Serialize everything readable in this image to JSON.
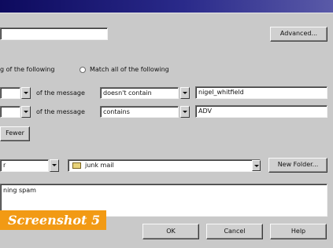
{
  "advanced_label": "Advanced...",
  "match_any_label": "g of the following",
  "match_all_label": "Match all of the following",
  "rules": [
    {
      "connector": "of the message",
      "operator": "doesn't contain",
      "value": "nigel_whitfield"
    },
    {
      "connector": "of the message",
      "operator": "contains",
      "value": "ADV"
    }
  ],
  "fewer_label": "Fewer",
  "action_partial": "r",
  "folder_value": "junk mail",
  "new_folder_label": "New Folder...",
  "description_value": "ning spam",
  "caption": "Screenshot 5",
  "ok_label": "OK",
  "cancel_label": "Cancel",
  "help_label": "Help"
}
